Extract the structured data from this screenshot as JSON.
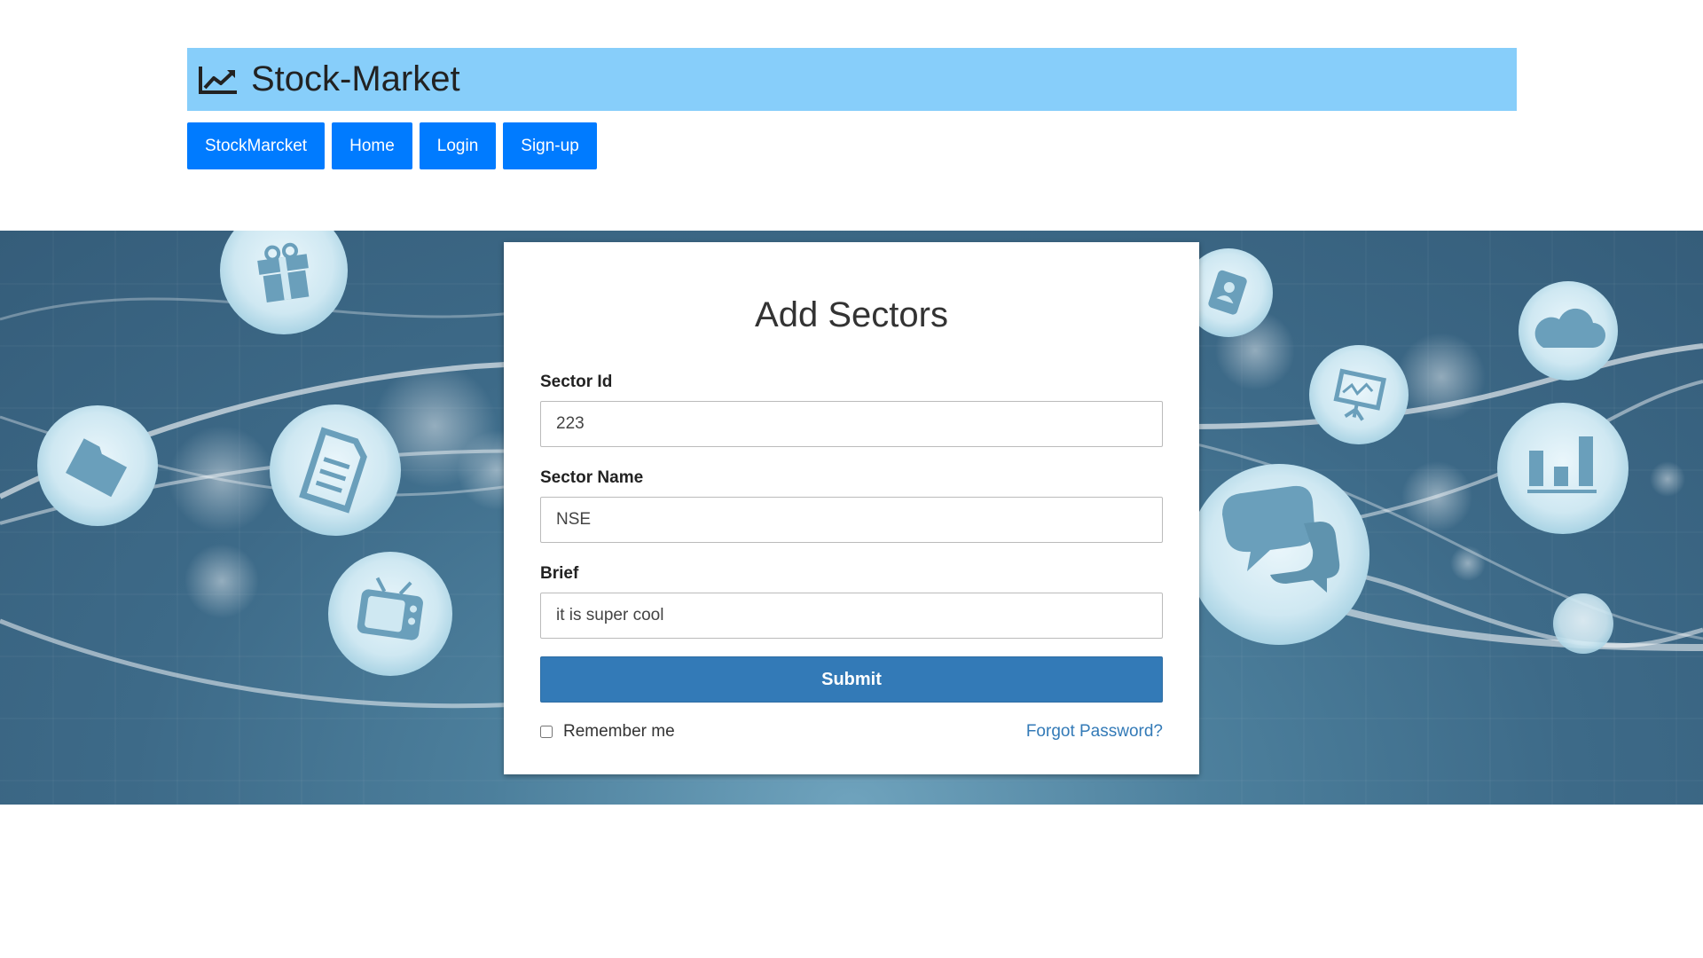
{
  "header": {
    "brand_icon": "line-chart-icon",
    "title": "Stock-Market",
    "brand_color": "#87cefa"
  },
  "nav": {
    "button_color": "#007bff",
    "items": [
      {
        "label": "StockMarcket"
      },
      {
        "label": "Home"
      },
      {
        "label": "Login"
      },
      {
        "label": "Sign-up"
      }
    ]
  },
  "form": {
    "title": "Add Sectors",
    "fields": {
      "sector_id": {
        "label": "Sector Id",
        "value": "223"
      },
      "sector_name": {
        "label": "Sector Name",
        "value": "NSE"
      },
      "brief": {
        "label": "Brief",
        "value": "it is super cool"
      }
    },
    "submit_label": "Submit",
    "submit_color": "#337ab7",
    "remember_label": "Remember me",
    "remember_checked": false,
    "forgot_label": "Forgot Password?"
  },
  "banner": {
    "icons": [
      "gift-icon",
      "folder-icon",
      "document-icon",
      "tv-icon",
      "contact-book-icon",
      "presentation-icon",
      "cloud-icon",
      "bar-chart-icon",
      "chat-bubbles-icon"
    ]
  }
}
